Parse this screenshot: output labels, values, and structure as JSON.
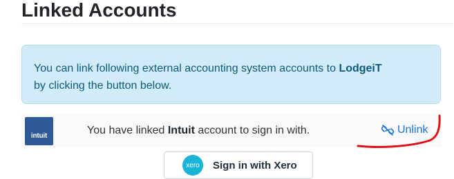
{
  "page": {
    "title": "Linked Accounts"
  },
  "alert": {
    "text_before": "You can link following external accounting system accounts to ",
    "brand": "LodgeiT",
    "text_after": " by clicking the button below."
  },
  "linked_account": {
    "logo_text": "intuit",
    "text_before": "You have linked ",
    "provider": "Intuit",
    "text_after": " account to sign in with.",
    "unlink_label": "Unlink",
    "unlink_icon": "unlink-icon"
  },
  "xero": {
    "logo_text": "xero",
    "button_label": "Sign in with Xero"
  },
  "colors": {
    "alert_bg": "#d1ecf8",
    "link": "#1a73d9",
    "intuit_blue": "#2e5a9a",
    "xero_blue": "#1ab4d7",
    "annotation_red": "#e0101a"
  }
}
